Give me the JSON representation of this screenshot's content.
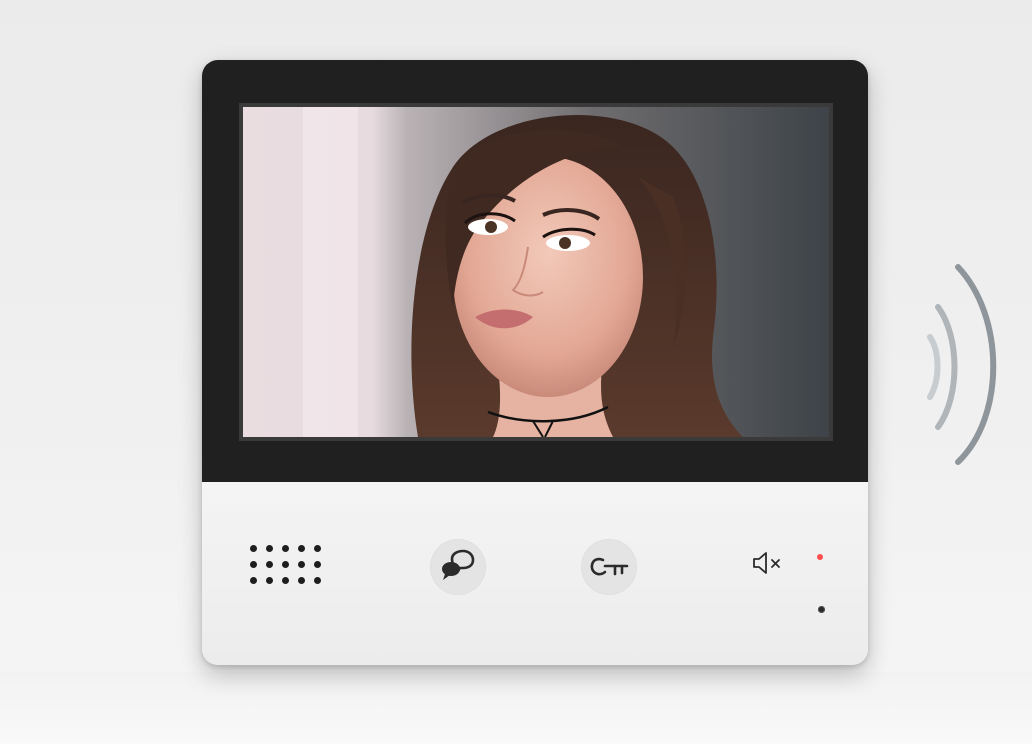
{
  "device": {
    "screen": {
      "view": "visitor-camera-feed"
    },
    "controls": {
      "talk": {
        "icon": "speech-bubbles-icon"
      },
      "unlock": {
        "icon": "key-icon"
      },
      "mute": {
        "icon": "speaker-mute-icon"
      }
    },
    "indicators": {
      "power_led_color": "#ff4d4d",
      "sensor_color": "#2a2a2a"
    }
  },
  "wireless": {
    "icon": "wireless-signal-icon",
    "color": "#8e959b"
  },
  "colors": {
    "bezel": "#202020",
    "panel": "#f0f0f0",
    "button": "#e4e4e4",
    "icon": "#2b2b2b"
  }
}
